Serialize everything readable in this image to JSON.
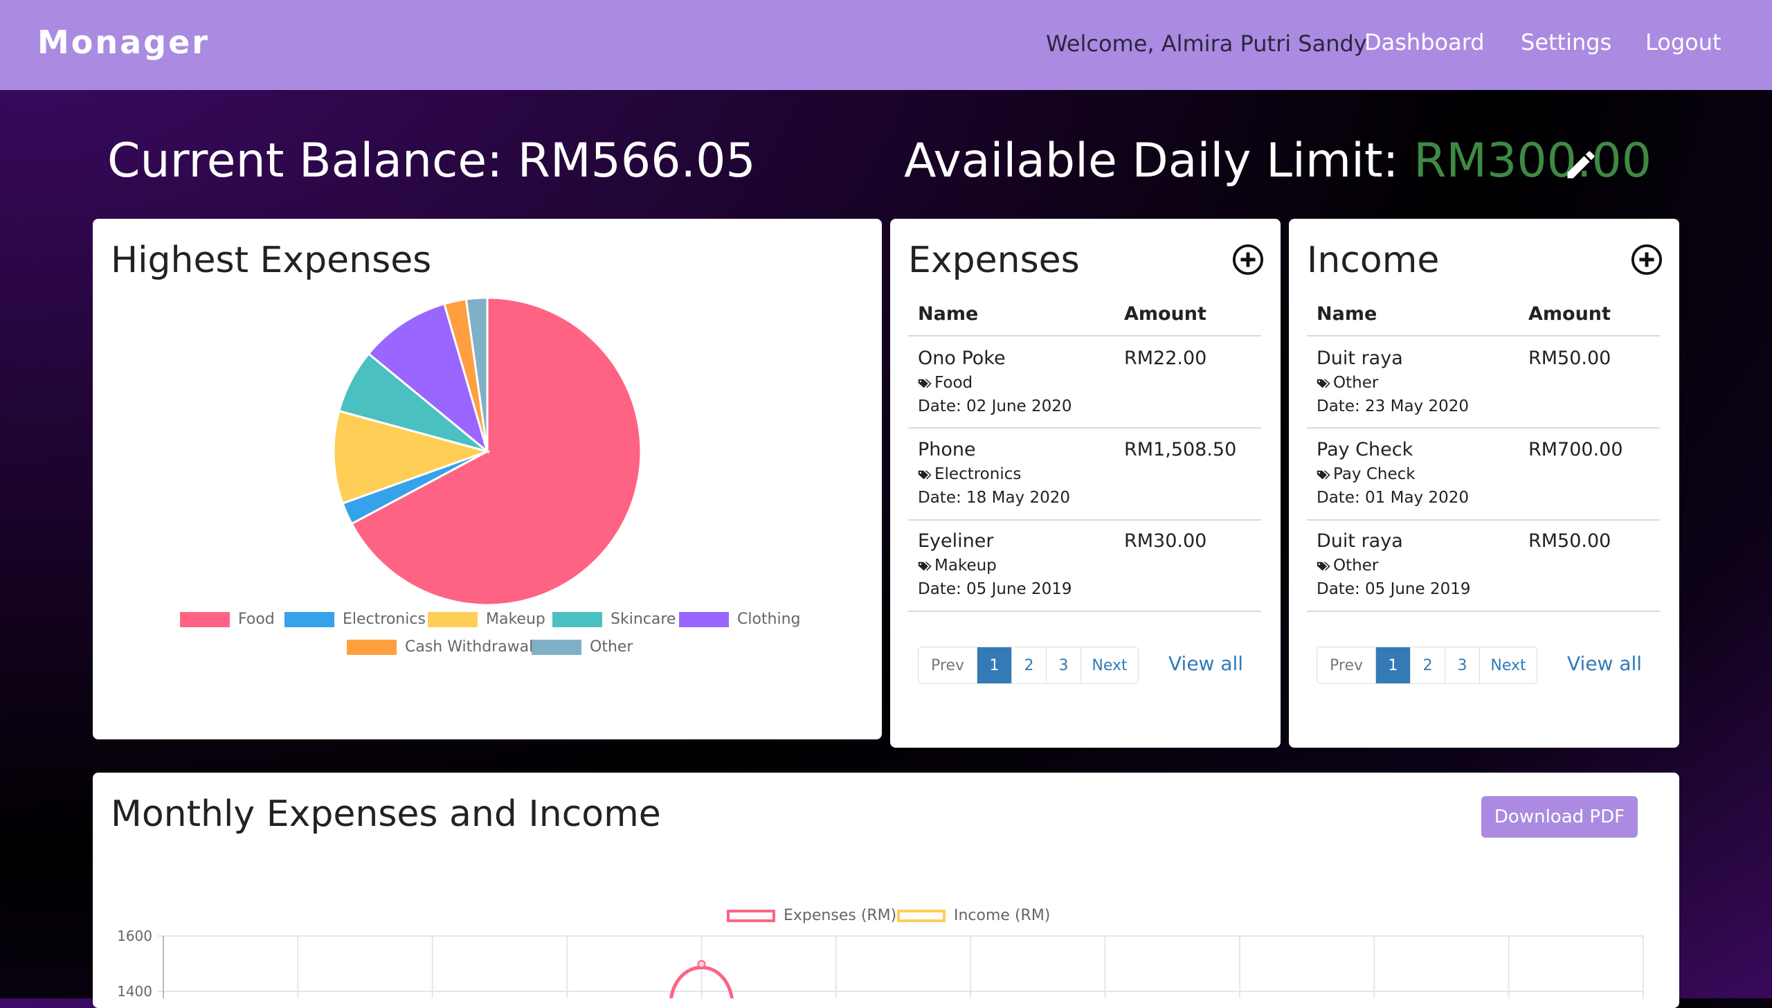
{
  "navbar": {
    "brand": "Monager",
    "welcome": "Welcome, Almira Putri Sandy",
    "links": [
      "Dashboard",
      "Settings",
      "Logout"
    ]
  },
  "summary": {
    "balance_label": "Current Balance: RM566.05",
    "limit_label": "Available Daily Limit: ",
    "limit_value": "RM300.00"
  },
  "highest_expenses": {
    "title": "Highest Expenses",
    "legend": [
      "Food",
      "Electronics",
      "Makeup",
      "Skincare",
      "Clothing",
      "Cash Withdrawal",
      "Other"
    ]
  },
  "expenses": {
    "title": "Expenses",
    "col_name": "Name",
    "col_amount": "Amount",
    "rows": [
      {
        "name": "Ono Poke",
        "amount": "RM22.00",
        "category": "Food",
        "date": "Date: 02 June 2020"
      },
      {
        "name": "Phone",
        "amount": "RM1,508.50",
        "category": "Electronics",
        "date": "Date: 18 May 2020"
      },
      {
        "name": "Eyeliner",
        "amount": "RM30.00",
        "category": "Makeup",
        "date": "Date: 05 June 2019"
      }
    ],
    "pager": [
      "Prev",
      "1",
      "2",
      "3",
      "Next"
    ],
    "view_all": "View all"
  },
  "income": {
    "title": "Income",
    "col_name": "Name",
    "col_amount": "Amount",
    "rows": [
      {
        "name": "Duit raya",
        "amount": "RM50.00",
        "category": "Other",
        "date": "Date: 23 May 2020"
      },
      {
        "name": "Pay Check",
        "amount": "RM700.00",
        "category": "Pay Check",
        "date": "Date: 01 May 2020"
      },
      {
        "name": "Duit raya",
        "amount": "RM50.00",
        "category": "Other",
        "date": "Date: 05 June 2019"
      }
    ],
    "pager": [
      "Prev",
      "1",
      "2",
      "3",
      "Next"
    ],
    "view_all": "View all"
  },
  "monthly": {
    "title": "Monthly Expenses and Income",
    "download": "Download PDF",
    "legend": [
      "Expenses (RM)",
      "Income (RM)"
    ]
  },
  "chart_data": [
    {
      "type": "pie",
      "title": "Highest Expenses",
      "categories": [
        "Food",
        "Electronics",
        "Makeup",
        "Skincare",
        "Clothing",
        "Cash Withdrawal",
        "Other"
      ],
      "values": [
        67,
        2.3,
        9.7,
        6.7,
        9.5,
        2.3,
        2.2
      ],
      "colors": [
        "#ff6384",
        "#36a2eb",
        "#ffce56",
        "#4bc0c0",
        "#9966ff",
        "#ff9f40",
        "#7fb0c8"
      ],
      "legend": "bottom"
    },
    {
      "type": "line",
      "series": [
        {
          "name": "Expenses (RM)",
          "color": "#ff6384"
        },
        {
          "name": "Income (RM)",
          "color": "#ffce56"
        }
      ],
      "y_ticks": [
        1600,
        1400
      ],
      "legend": "top",
      "grid": true,
      "peak_visible": 1508.5
    }
  ]
}
